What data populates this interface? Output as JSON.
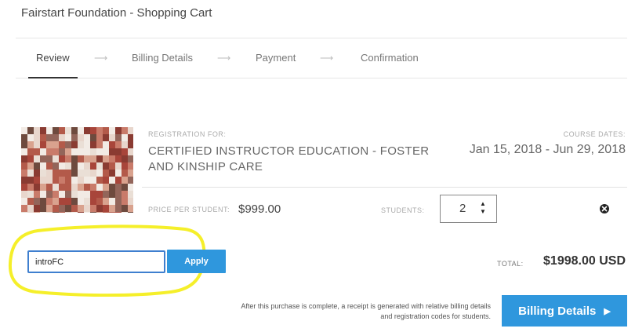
{
  "header": {
    "title": "Fairstart Foundation - Shopping Cart"
  },
  "steps": [
    {
      "label": "Review",
      "active": true
    },
    {
      "label": "Billing Details",
      "active": false
    },
    {
      "label": "Payment",
      "active": false
    },
    {
      "label": "Confirmation",
      "active": false
    }
  ],
  "step_separator": "⟶",
  "cart_item": {
    "registration_label": "REGISTRATION FOR:",
    "title": "CERTIFIED INSTRUCTOR EDUCATION - FOSTER AND KINSHIP CARE",
    "dates_label": "COURSE DATES:",
    "dates": "Jan 15, 2018 - Jun 29, 2018",
    "price_label": "PRICE PER STUDENT:",
    "price": "$999.00",
    "students_label": "STUDENTS:",
    "students": "2",
    "stepper_icon": "up-down-arrows-icon",
    "remove_icon": "close-circle-icon",
    "thumbnail_icon": "photo-collage-image"
  },
  "coupon": {
    "value": "introFC",
    "apply_label": "Apply"
  },
  "totals": {
    "label": "TOTAL:",
    "value": "$1998.00 USD"
  },
  "footer": {
    "note": "After this purchase is complete, a receipt is generated with relative billing details and registration codes for students.",
    "next_label": "Billing Details",
    "next_icon": "chevron-right-icon"
  },
  "colors": {
    "accent": "#2f97dd",
    "highlight": "#f5ef2a",
    "input_border": "#3f7fcf"
  }
}
